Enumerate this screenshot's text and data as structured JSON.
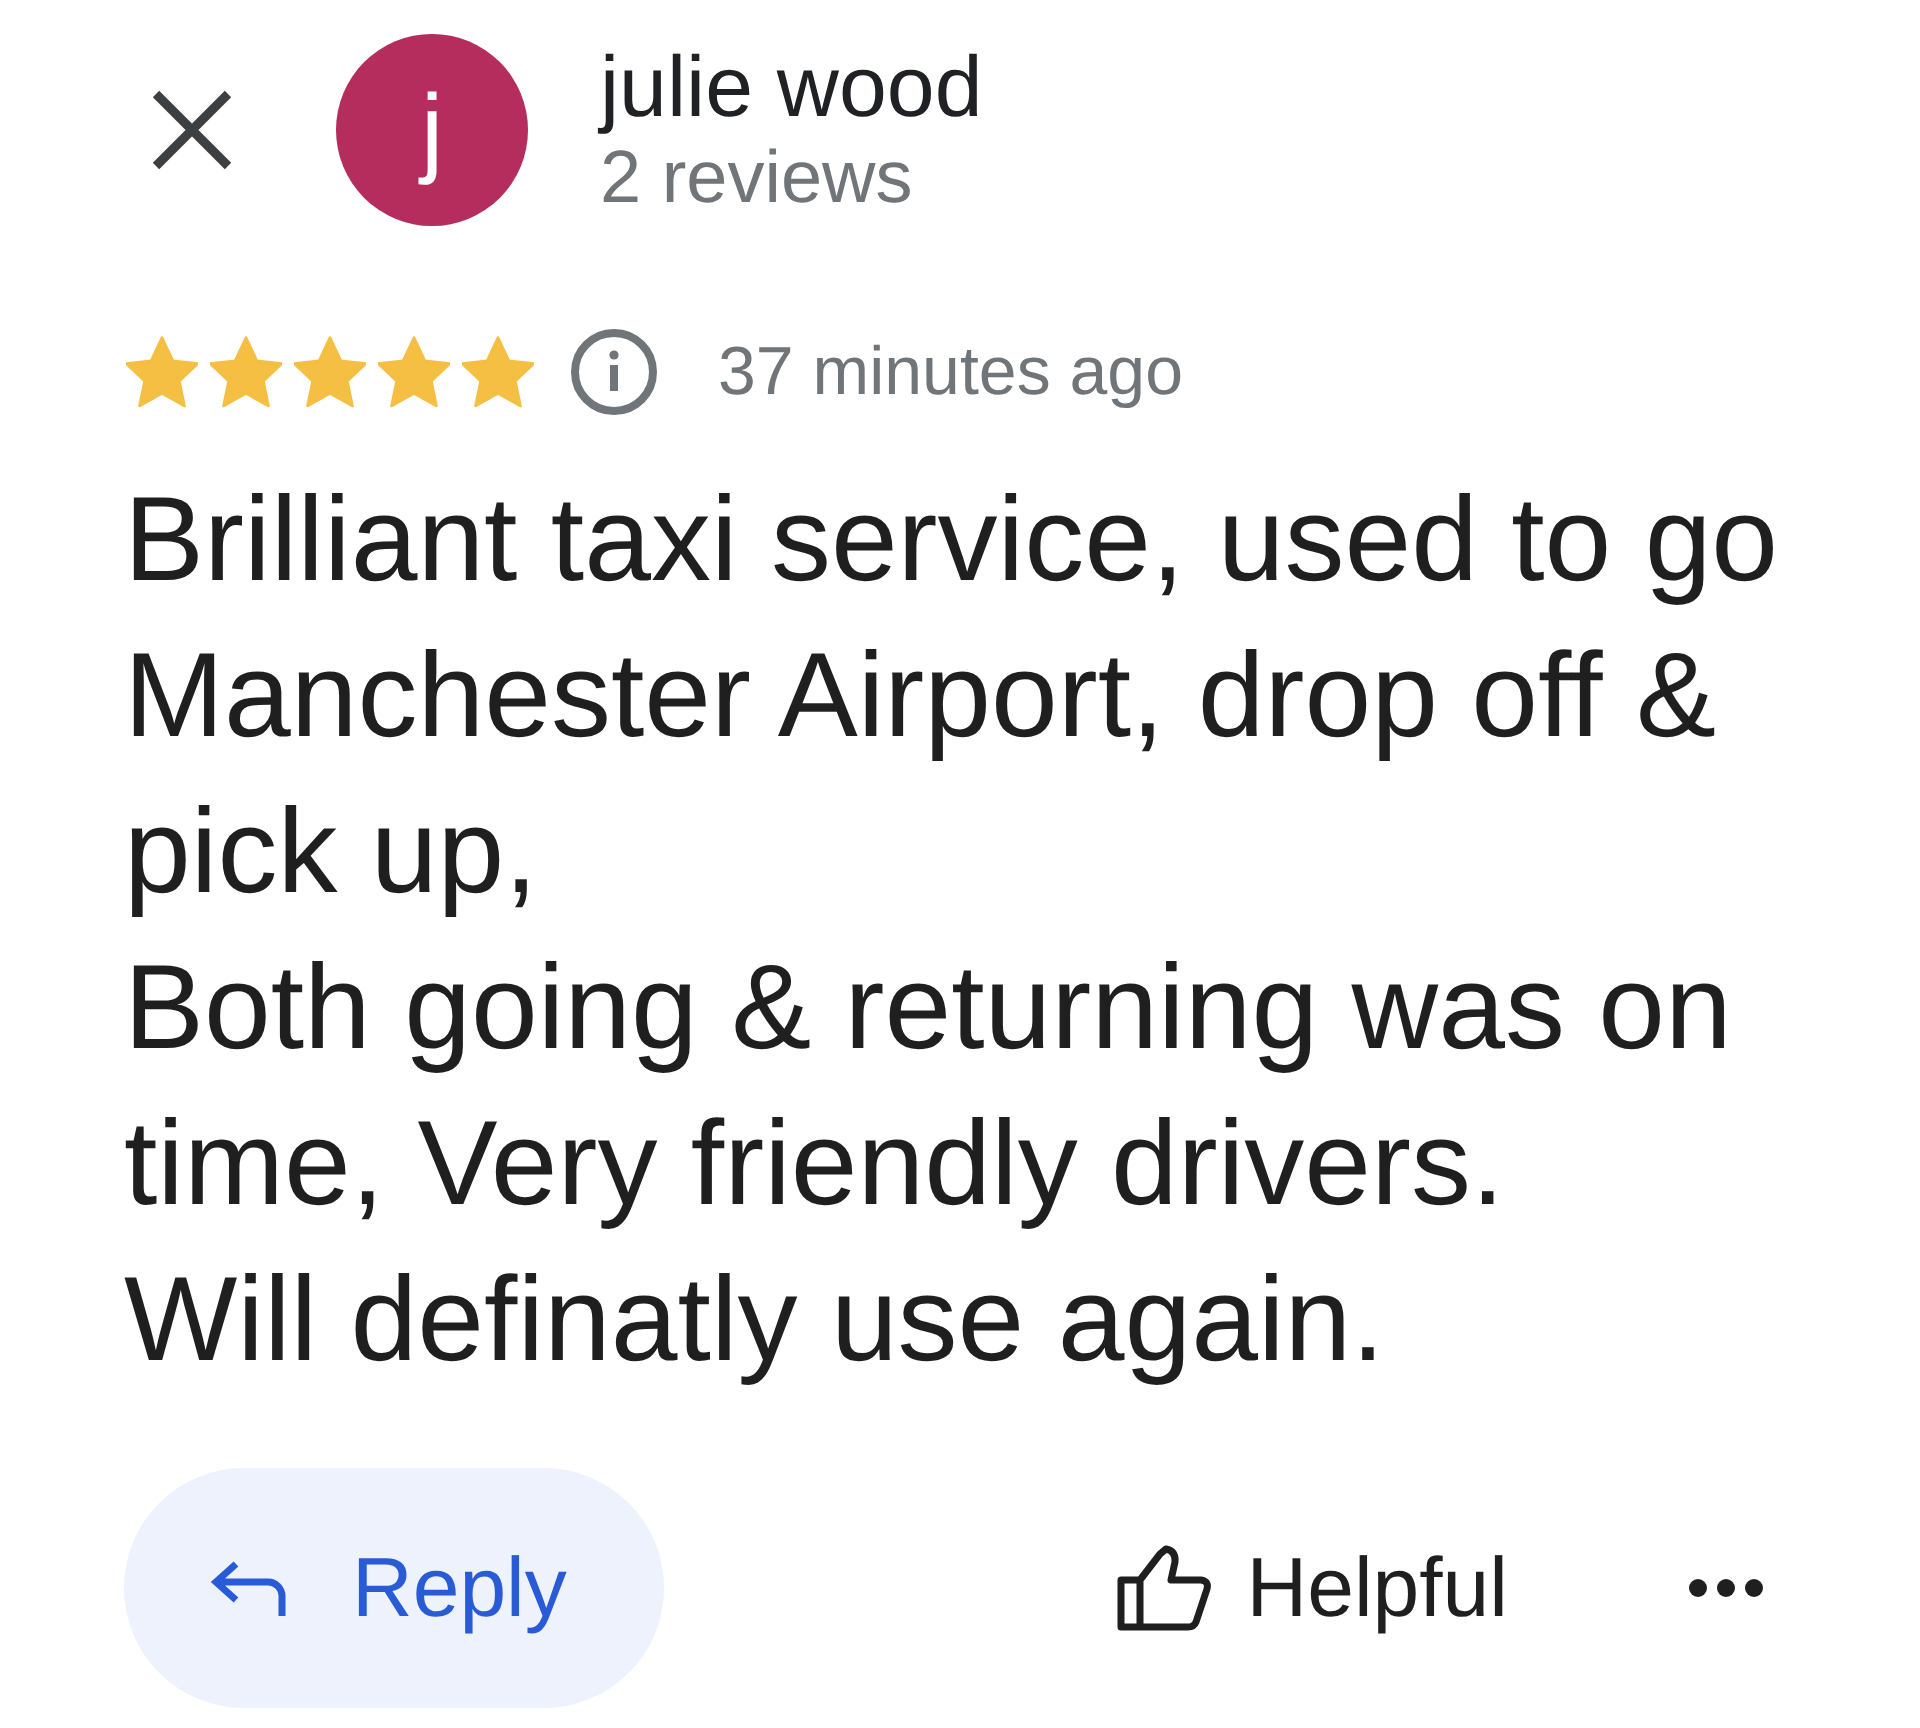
{
  "reviewer": {
    "initial": "j",
    "name": "julie wood",
    "review_count": "2 reviews"
  },
  "review": {
    "stars": 5,
    "time": "37 minutes ago",
    "text": "Brilliant taxi service, used to go Manchester Airport, drop off & pick up,\nBoth going & returning was on time, Very friendly drivers.\nWill definatly use again."
  },
  "actions": {
    "reply": "Reply",
    "helpful": "Helpful"
  }
}
